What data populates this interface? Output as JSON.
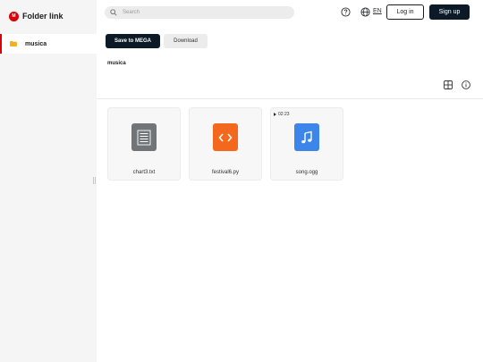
{
  "brand": {
    "logo_letter": "M",
    "title": "Folder link",
    "accent": "#d90007"
  },
  "sidebar": {
    "items": [
      {
        "label": "musica",
        "icon": "folder-icon",
        "active": true
      }
    ]
  },
  "header": {
    "search_placeholder": "Search",
    "help_icon": "help-circle-icon",
    "language_icon": "globe-icon",
    "language": "EN",
    "login_label": "Log in",
    "signup_label": "Sign up"
  },
  "actions": {
    "save_label": "Save to MEGA",
    "download_label": "Download"
  },
  "breadcrumb": "musica",
  "view_controls": {
    "grid_icon": "grid-view-icon",
    "info_icon": "info-icon"
  },
  "files": [
    {
      "name": "chart3.txt",
      "type": "text",
      "icon": "text-file-icon",
      "color": "#717577"
    },
    {
      "name": "festival6.py",
      "type": "code",
      "icon": "code-file-icon",
      "color": "#f3681c"
    },
    {
      "name": "song.ogg",
      "type": "audio",
      "icon": "audio-file-icon",
      "color": "#3c86e9",
      "duration": "02:23"
    }
  ]
}
